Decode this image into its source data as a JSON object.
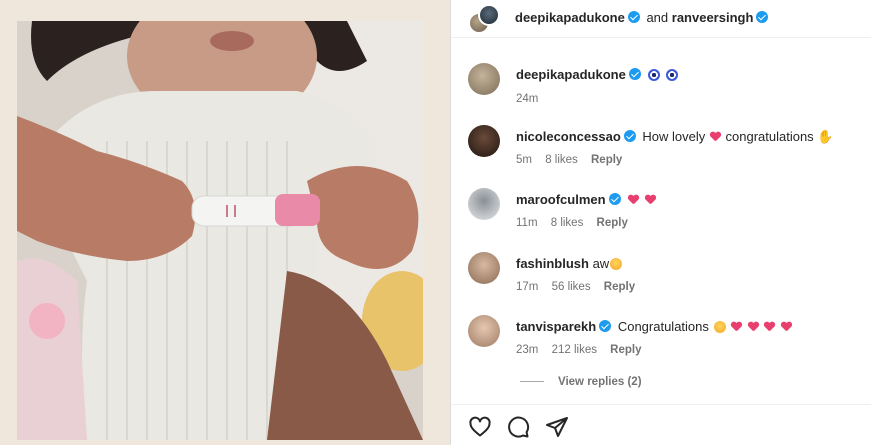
{
  "header": {
    "user1": "deepikapadukone",
    "conjunction": "and",
    "user2": "ranveersingh"
  },
  "comments": [
    {
      "user": "deepikapadukone",
      "text": "",
      "emoji": "evil-eye",
      "time": "24m",
      "likes": "",
      "reply": ""
    },
    {
      "user": "nicoleconcessao",
      "text": "How lovely",
      "text2": "congratulations",
      "time": "5m",
      "likes": "8 likes",
      "reply": "Reply"
    },
    {
      "user": "maroofculmen",
      "text": "",
      "time": "11m",
      "likes": "8 likes",
      "reply": "Reply"
    },
    {
      "user": "fashinblush",
      "text": "aw",
      "time": "17m",
      "likes": "56 likes",
      "reply": "Reply"
    },
    {
      "user": "tanvisparekh",
      "text": "Congratulations",
      "time": "23m",
      "likes": "212 likes",
      "reply": "Reply"
    }
  ],
  "view_replies": "View replies (2)",
  "actions": {
    "like": "heart-icon",
    "comment": "comment-icon",
    "share": "share-icon"
  },
  "colors": {
    "verified": "#1d9bf0",
    "heart": "#e83f6f",
    "meta_text": "#737373"
  }
}
